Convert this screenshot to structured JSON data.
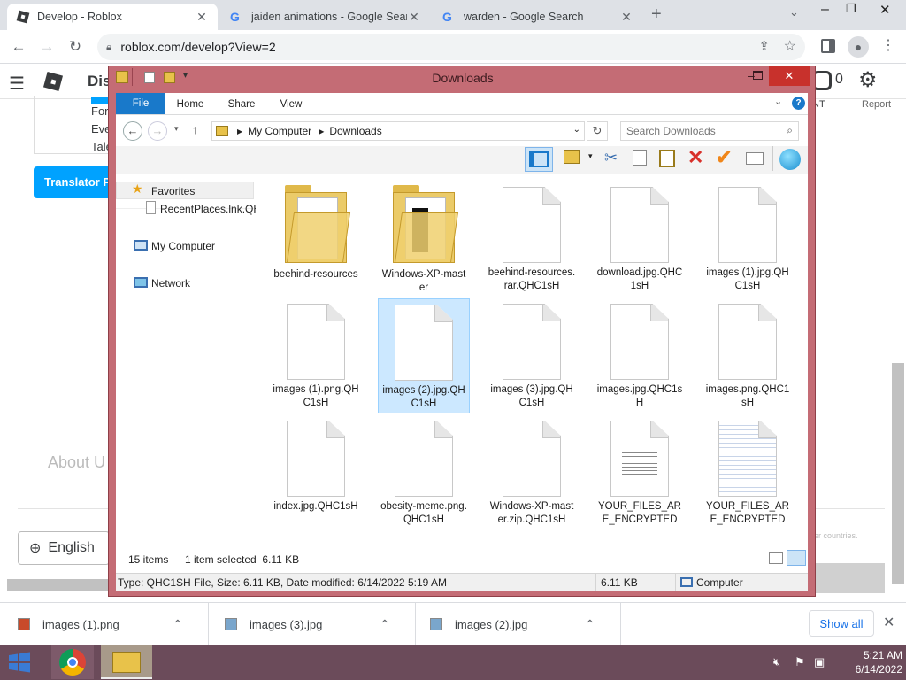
{
  "chrome": {
    "tabs": [
      {
        "title": "Develop - Roblox",
        "active": true
      },
      {
        "title": "jaiden animations - Google Searc",
        "active": false
      },
      {
        "title": "warden - Google Search",
        "active": false
      }
    ],
    "new_tab": "+",
    "url": "roblox.com/develop?View=2"
  },
  "roblox": {
    "header_text": "Dis",
    "robux": "0",
    "report_label": "Report",
    "nt_label": "NT",
    "side_lines": [
      "For",
      "Eve",
      "Tale"
    ],
    "translator_btn": "Translator P",
    "about": "About U",
    "footer_note": "er countries.",
    "language": "English"
  },
  "explorer": {
    "title": "Downloads",
    "ribbon": {
      "file": "File",
      "home": "Home",
      "share": "Share",
      "view": "View"
    },
    "path": [
      "My Computer",
      "Downloads"
    ],
    "search_placeholder": "Search Downloads",
    "nav": {
      "favorites": "Favorites",
      "recent": "RecentPlaces.lnk.QH",
      "my_computer": "My Computer",
      "network": "Network"
    },
    "items": [
      {
        "name": "beehind-resources",
        "kind": "folder"
      },
      {
        "name": "Windows-XP-master",
        "kind": "folder"
      },
      {
        "name": "beehind-resources.rar.QHC1sH",
        "kind": "file"
      },
      {
        "name": "download.jpg.QHC1sH",
        "kind": "file"
      },
      {
        "name": "images (1).jpg.QHC1sH",
        "kind": "file"
      },
      {
        "name": "images (1).png.QHC1sH",
        "kind": "file"
      },
      {
        "name": "images (2).jpg.QHC1sH",
        "kind": "file",
        "selected": true
      },
      {
        "name": "images (3).jpg.QHC1sH",
        "kind": "file"
      },
      {
        "name": "images.jpg.QHC1sH",
        "kind": "file"
      },
      {
        "name": "images.png.QHC1sH",
        "kind": "file"
      },
      {
        "name": "index.jpg.QHC1sH",
        "kind": "file"
      },
      {
        "name": "obesity-meme.png.QHC1sH",
        "kind": "file"
      },
      {
        "name": "Windows-XP-master.zip.QHC1sH",
        "kind": "file"
      },
      {
        "name": "YOUR_FILES_ARE_ENCRYPTED",
        "kind": "text"
      },
      {
        "name": "YOUR_FILES_ARE_ENCRYPTED",
        "kind": "note"
      }
    ],
    "status_count": "15 items",
    "status_selected": "1 item selected  6.11 KB",
    "details": "Type: QHC1SH File, Size: 6.11 KB, Date modified: 6/14/2022 5:19 AM",
    "details_size": "6.11 KB",
    "details_location": "Computer"
  },
  "downloads": [
    {
      "name": "images (1).png"
    },
    {
      "name": "images (3).jpg"
    },
    {
      "name": "images (2).jpg"
    }
  ],
  "show_all": "Show all",
  "taskbar": {
    "time": "5:21 AM",
    "date": "6/14/2022"
  },
  "colors": {
    "window_frame": "#c46c75",
    "accent": "#1a73e8",
    "file_tab": "#1979ca",
    "taskbar": "#6b4b5a",
    "roblox_blue": "#00a2ff"
  }
}
